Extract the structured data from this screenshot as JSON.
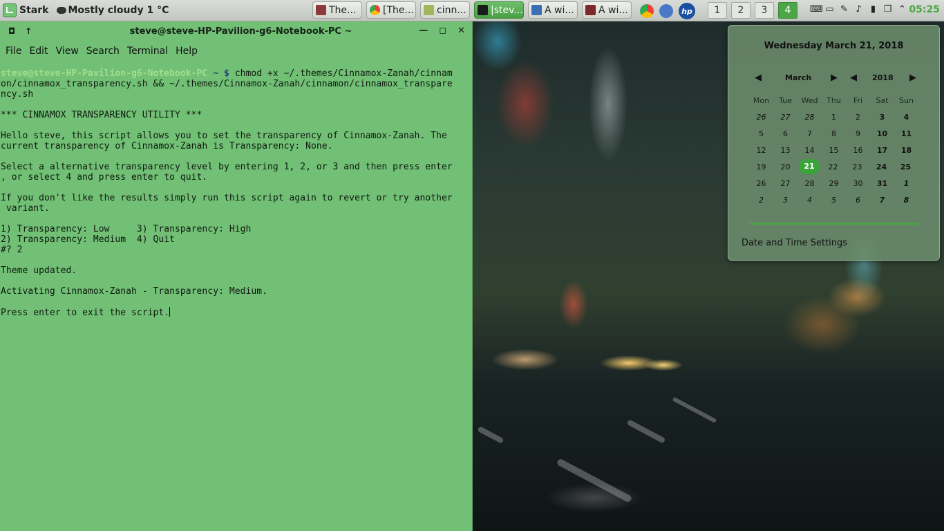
{
  "panel": {
    "menu_label": "Stark",
    "weather": "Mostly cloudy 1 °C",
    "tasks": [
      {
        "label": "The...",
        "active": false
      },
      {
        "label": "[The...",
        "active": false
      },
      {
        "label": "cinn...",
        "active": false
      },
      {
        "label": "|stev...",
        "active": true
      },
      {
        "label": "A wi...",
        "active": false
      },
      {
        "label": "A wi...",
        "active": false
      }
    ],
    "workspaces": [
      "1",
      "2",
      "3",
      "4"
    ],
    "active_workspace": "4",
    "clock": "05:25"
  },
  "terminal": {
    "title": "steve@steve-HP-Pavilion-g6-Notebook-PC ~",
    "menu": [
      "File",
      "Edit",
      "View",
      "Search",
      "Terminal",
      "Help"
    ],
    "prompt_user": "steve@steve-HP-Pavilion-g6-Notebook-PC",
    "prompt_path": " ~ $",
    "command": " chmod +x ~/.themes/Cinnamox-Zanah/cinnam",
    "lines": [
      "on/cinnamox_transparency.sh && ~/.themes/Cinnamox-Zanah/cinnamon/cinnamox_transpare",
      "ncy.sh",
      "",
      "*** CINNAMOX TRANSPARENCY UTILITY ***",
      "",
      "Hello steve, this script allows you to set the transparency of Cinnamox-Zanah. The",
      "current transparency of Cinnamox-Zanah is Transparency: None.",
      "",
      "Select a alternative transparency level by entering 1, 2, or 3 and then press enter",
      ", or select 4 and press enter to quit.",
      "",
      "If you don't like the results simply run this script again to revert or try another",
      " variant.",
      "",
      "1) Transparency: Low     3) Transparency: High",
      "2) Transparency: Medium  4) Quit",
      "#? 2",
      "",
      "Theme updated.",
      "",
      "Activating Cinnamox-Zanah - Transparency: Medium.",
      "",
      "Press enter to exit the script."
    ]
  },
  "calendar": {
    "full_date": "Wednesday March 21, 2018",
    "month": "March",
    "year": "2018",
    "weekdays": [
      "Mon",
      "Tue",
      "Wed",
      "Thu",
      "Fri",
      "Sat",
      "Sun"
    ],
    "weeks": [
      [
        "26",
        "27",
        "28",
        "1",
        "2",
        "3",
        "4"
      ],
      [
        "5",
        "6",
        "7",
        "8",
        "9",
        "10",
        "11"
      ],
      [
        "12",
        "13",
        "14",
        "15",
        "16",
        "17",
        "18"
      ],
      [
        "19",
        "20",
        "21",
        "22",
        "23",
        "24",
        "25"
      ],
      [
        "26",
        "27",
        "28",
        "29",
        "30",
        "31",
        "1"
      ],
      [
        "2",
        "3",
        "4",
        "5",
        "6",
        "7",
        "8"
      ]
    ],
    "today": "21",
    "settings_label": "Date and Time Settings"
  },
  "icons": {
    "taskbar": [
      "terminal-app-icon",
      "chrome-icon",
      "folder-icon",
      "terminal-icon",
      "app-icon",
      "app-icon"
    ]
  }
}
